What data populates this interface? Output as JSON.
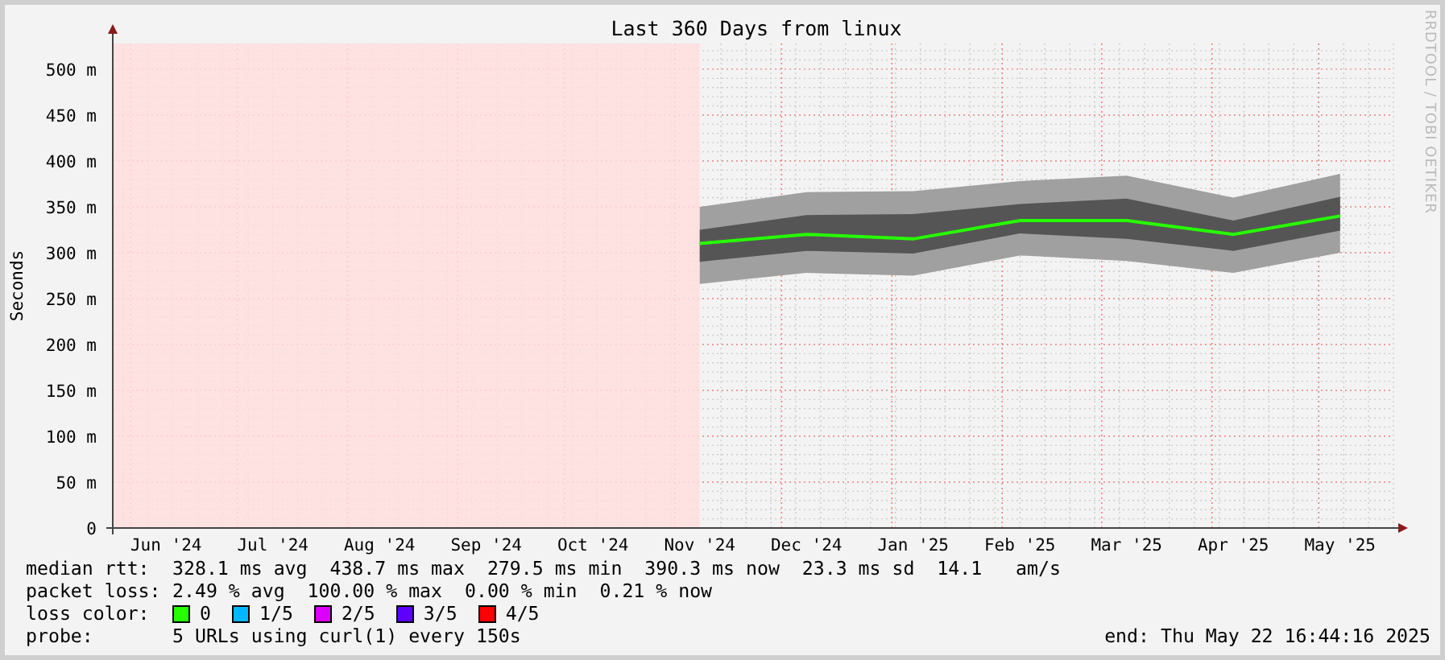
{
  "chart": {
    "side_note": "RRDTOOL / TOBI OETIKER",
    "chart_data": {
      "type": "line",
      "title": "Last 360 Days from linux",
      "ylabel": "Seconds",
      "categories": [
        "Jun '24",
        "Jul '24",
        "Aug '24",
        "Sep '24",
        "Oct '24",
        "Nov '24",
        "Dec '24",
        "Jan '25",
        "Feb '25",
        "Mar '25",
        "Apr '25",
        "May '25"
      ],
      "series": [
        {
          "name": "median rtt:",
          "color": "#26ff00",
          "values": [
            null,
            null,
            null,
            null,
            null,
            310,
            320,
            315,
            335,
            335,
            320,
            340
          ]
        }
      ],
      "grid": true,
      "ylim": [
        0,
        528
      ],
      "yticks": [
        {
          "value": 0,
          "label": "0"
        },
        {
          "value": 50,
          "label": "50 m"
        },
        {
          "value": 100,
          "label": "100 m"
        },
        {
          "value": 150,
          "label": "150 m"
        },
        {
          "value": 200,
          "label": "200 m"
        },
        {
          "value": 250,
          "label": "250 m"
        },
        {
          "value": 300,
          "label": "300 m"
        },
        {
          "value": 350,
          "label": "350 m"
        },
        {
          "value": 400,
          "label": "400 m"
        },
        {
          "value": 450,
          "label": "450 m"
        },
        {
          "value": 500,
          "label": "500 m"
        }
      ]
    }
  },
  "legend": {
    "rows": [
      {
        "kind": "series",
        "text": "328.1 ms avg  438.7 ms max  279.5 ms min  390.3 ms now  23.3 ms sd  14.1   am/s"
      },
      {
        "kind": "stats",
        "label": "packet loss:",
        "text": "2.49 % avg  100.00 % max  0.00 % min  0.21 % now"
      },
      {
        "kind": "colors",
        "label": "loss color:",
        "items": [
          {
            "label": "0",
            "color": "#26ff00"
          },
          {
            "label": "1/5",
            "color": "#00b8ff"
          },
          {
            "label": "2/5",
            "color": "#dd00ff"
          },
          {
            "label": "3/5",
            "color": "#5e00ff"
          },
          {
            "label": "4/5",
            "color": "#ff0000"
          }
        ]
      },
      {
        "kind": "probe",
        "label": "probe:",
        "text": "5 URLs using curl(1) every 150s",
        "end": "end: Thu May 22 16:44:16 2025"
      }
    ]
  }
}
